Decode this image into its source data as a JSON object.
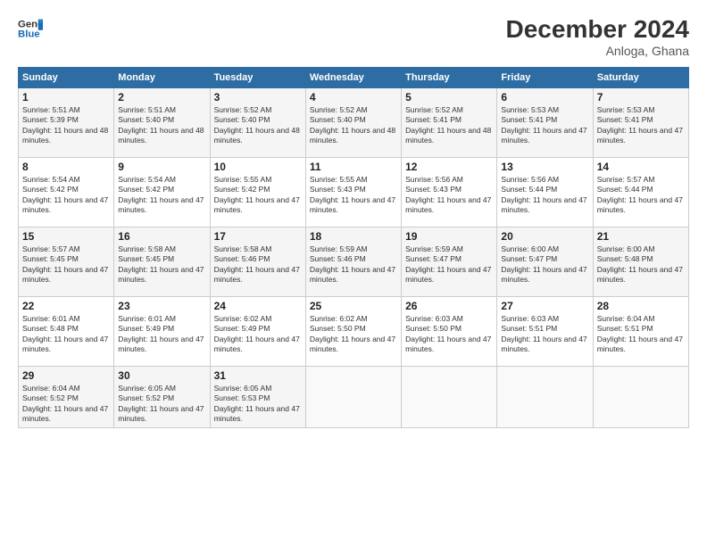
{
  "header": {
    "logo_line1": "General",
    "logo_line2": "Blue",
    "title": "December 2024",
    "subtitle": "Anloga, Ghana"
  },
  "weekdays": [
    "Sunday",
    "Monday",
    "Tuesday",
    "Wednesday",
    "Thursday",
    "Friday",
    "Saturday"
  ],
  "weeks": [
    [
      {
        "day": 1,
        "sunrise": "5:51 AM",
        "sunset": "5:39 PM",
        "daylight": "11 hours and 48 minutes."
      },
      {
        "day": 2,
        "sunrise": "5:51 AM",
        "sunset": "5:40 PM",
        "daylight": "11 hours and 48 minutes."
      },
      {
        "day": 3,
        "sunrise": "5:52 AM",
        "sunset": "5:40 PM",
        "daylight": "11 hours and 48 minutes."
      },
      {
        "day": 4,
        "sunrise": "5:52 AM",
        "sunset": "5:40 PM",
        "daylight": "11 hours and 48 minutes."
      },
      {
        "day": 5,
        "sunrise": "5:52 AM",
        "sunset": "5:41 PM",
        "daylight": "11 hours and 48 minutes."
      },
      {
        "day": 6,
        "sunrise": "5:53 AM",
        "sunset": "5:41 PM",
        "daylight": "11 hours and 47 minutes."
      },
      {
        "day": 7,
        "sunrise": "5:53 AM",
        "sunset": "5:41 PM",
        "daylight": "11 hours and 47 minutes."
      }
    ],
    [
      {
        "day": 8,
        "sunrise": "5:54 AM",
        "sunset": "5:42 PM",
        "daylight": "11 hours and 47 minutes."
      },
      {
        "day": 9,
        "sunrise": "5:54 AM",
        "sunset": "5:42 PM",
        "daylight": "11 hours and 47 minutes."
      },
      {
        "day": 10,
        "sunrise": "5:55 AM",
        "sunset": "5:42 PM",
        "daylight": "11 hours and 47 minutes."
      },
      {
        "day": 11,
        "sunrise": "5:55 AM",
        "sunset": "5:43 PM",
        "daylight": "11 hours and 47 minutes."
      },
      {
        "day": 12,
        "sunrise": "5:56 AM",
        "sunset": "5:43 PM",
        "daylight": "11 hours and 47 minutes."
      },
      {
        "day": 13,
        "sunrise": "5:56 AM",
        "sunset": "5:44 PM",
        "daylight": "11 hours and 47 minutes."
      },
      {
        "day": 14,
        "sunrise": "5:57 AM",
        "sunset": "5:44 PM",
        "daylight": "11 hours and 47 minutes."
      }
    ],
    [
      {
        "day": 15,
        "sunrise": "5:57 AM",
        "sunset": "5:45 PM",
        "daylight": "11 hours and 47 minutes."
      },
      {
        "day": 16,
        "sunrise": "5:58 AM",
        "sunset": "5:45 PM",
        "daylight": "11 hours and 47 minutes."
      },
      {
        "day": 17,
        "sunrise": "5:58 AM",
        "sunset": "5:46 PM",
        "daylight": "11 hours and 47 minutes."
      },
      {
        "day": 18,
        "sunrise": "5:59 AM",
        "sunset": "5:46 PM",
        "daylight": "11 hours and 47 minutes."
      },
      {
        "day": 19,
        "sunrise": "5:59 AM",
        "sunset": "5:47 PM",
        "daylight": "11 hours and 47 minutes."
      },
      {
        "day": 20,
        "sunrise": "6:00 AM",
        "sunset": "5:47 PM",
        "daylight": "11 hours and 47 minutes."
      },
      {
        "day": 21,
        "sunrise": "6:00 AM",
        "sunset": "5:48 PM",
        "daylight": "11 hours and 47 minutes."
      }
    ],
    [
      {
        "day": 22,
        "sunrise": "6:01 AM",
        "sunset": "5:48 PM",
        "daylight": "11 hours and 47 minutes."
      },
      {
        "day": 23,
        "sunrise": "6:01 AM",
        "sunset": "5:49 PM",
        "daylight": "11 hours and 47 minutes."
      },
      {
        "day": 24,
        "sunrise": "6:02 AM",
        "sunset": "5:49 PM",
        "daylight": "11 hours and 47 minutes."
      },
      {
        "day": 25,
        "sunrise": "6:02 AM",
        "sunset": "5:50 PM",
        "daylight": "11 hours and 47 minutes."
      },
      {
        "day": 26,
        "sunrise": "6:03 AM",
        "sunset": "5:50 PM",
        "daylight": "11 hours and 47 minutes."
      },
      {
        "day": 27,
        "sunrise": "6:03 AM",
        "sunset": "5:51 PM",
        "daylight": "11 hours and 47 minutes."
      },
      {
        "day": 28,
        "sunrise": "6:04 AM",
        "sunset": "5:51 PM",
        "daylight": "11 hours and 47 minutes."
      }
    ],
    [
      {
        "day": 29,
        "sunrise": "6:04 AM",
        "sunset": "5:52 PM",
        "daylight": "11 hours and 47 minutes."
      },
      {
        "day": 30,
        "sunrise": "6:05 AM",
        "sunset": "5:52 PM",
        "daylight": "11 hours and 47 minutes."
      },
      {
        "day": 31,
        "sunrise": "6:05 AM",
        "sunset": "5:53 PM",
        "daylight": "11 hours and 47 minutes."
      },
      null,
      null,
      null,
      null
    ]
  ]
}
